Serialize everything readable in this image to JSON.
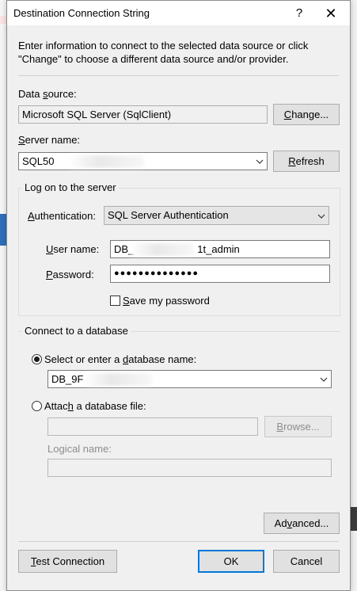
{
  "dialog": {
    "title": "Destination Connection String",
    "help_glyph": "?",
    "close_glyph": "✕",
    "intro": "Enter information to connect to the selected data source or click \"Change\" to choose a different data source and/or provider."
  },
  "data_source": {
    "label": "Data source:",
    "value": "Microsoft SQL Server (SqlClient)",
    "change_button": "Change..."
  },
  "server": {
    "label": "Server name:",
    "value": "SQL50",
    "refresh_button": "Refresh"
  },
  "logon": {
    "group_label": "Log on to the server",
    "auth_label": "Authentication:",
    "auth_value": "SQL Server Authentication",
    "user_label": "User name:",
    "user_prefix": "DB_",
    "user_suffix": "1t_admin",
    "password_label": "Password:",
    "password_mask": "●●●●●●●●●●●●●●",
    "save_password_label": "Save my password",
    "save_password_checked": false
  },
  "database": {
    "group_label": "Connect to a database",
    "select_label": "Select or enter a database name:",
    "select_checked": true,
    "db_value": "DB_9F",
    "attach_label": "Attach a database file:",
    "attach_checked": false,
    "browse_button": "Browse...",
    "logical_name_label": "Logical name:"
  },
  "footer": {
    "advanced_button": "Advanced...",
    "test_button": "Test Connection",
    "ok_button": "OK",
    "cancel_button": "Cancel"
  },
  "colors": {
    "default_button_border": "#0078d7",
    "dialog_bg": "#f0f0f0"
  }
}
